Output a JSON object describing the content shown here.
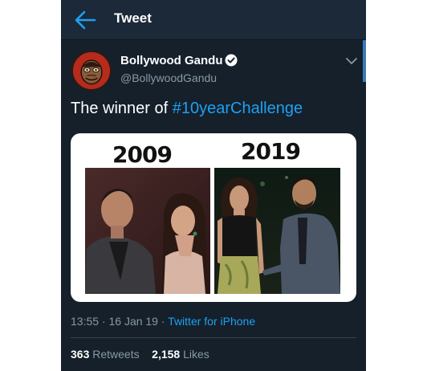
{
  "header": {
    "title": "Tweet",
    "back_icon": "arrow-left-icon"
  },
  "tweet": {
    "author": {
      "name": "Bollywood Gandu",
      "handle": "@BollywoodGandu",
      "verified": true
    },
    "text_prefix": "The winner of ",
    "hashtag": "#10yearChallenge",
    "media": {
      "left_year": "2009",
      "right_year": "2019"
    },
    "timestamp": "13:55 · 16 Jan 19 · ",
    "source": "Twitter for iPhone",
    "stats": {
      "retweets_count": "363",
      "retweets_label": "Retweets",
      "likes_count": "2,158",
      "likes_label": "Likes"
    }
  },
  "colors": {
    "background": "#15202b",
    "header": "#1c2938",
    "accent": "#1da1f2",
    "secondary_text": "#8899a6"
  }
}
